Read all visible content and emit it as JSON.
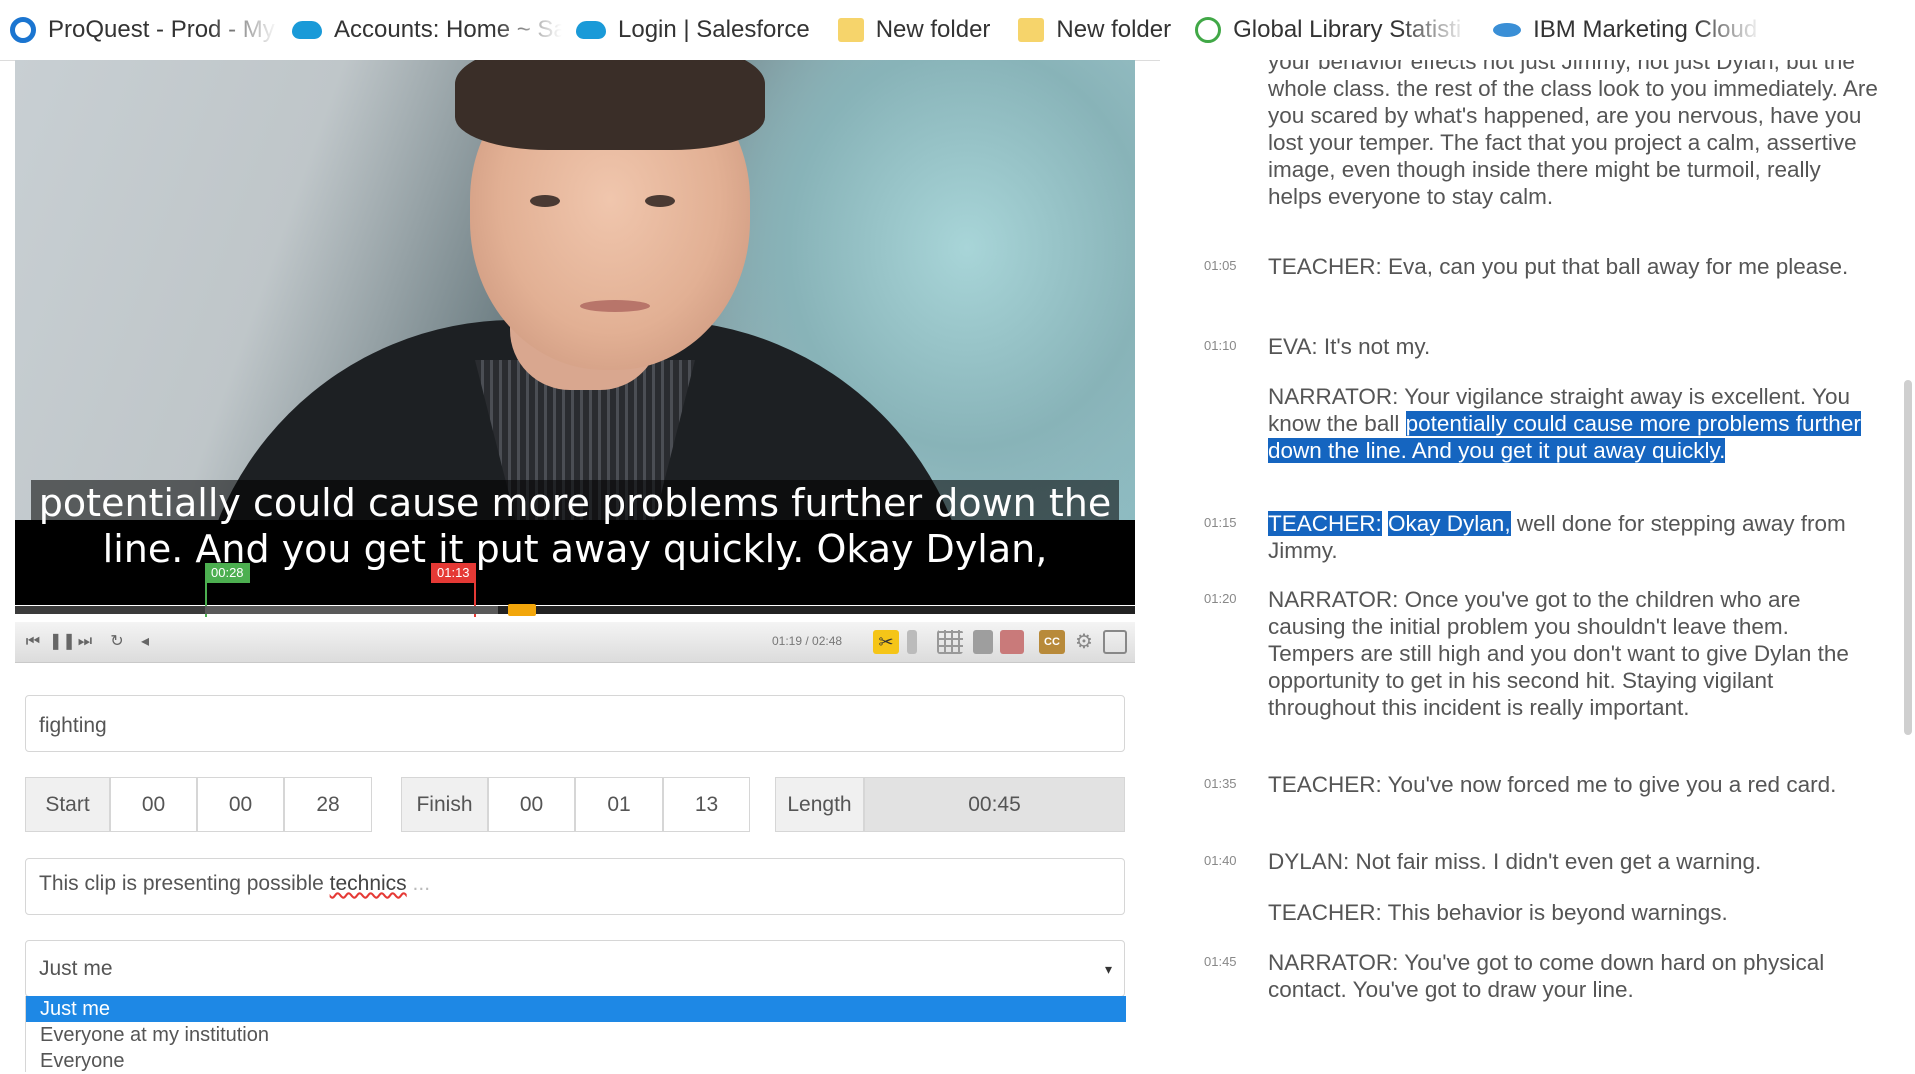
{
  "bookmarks": [
    {
      "label": "ProQuest - Prod - My",
      "icon": "proquest-icon"
    },
    {
      "label": "Accounts: Home ~ Sa",
      "icon": "salesforce-cloud-icon"
    },
    {
      "label": "Login | Salesforce",
      "icon": "salesforce-cloud-icon"
    },
    {
      "label": "New folder",
      "icon": "folder-icon"
    },
    {
      "label": "New folder",
      "icon": "folder-icon"
    },
    {
      "label": "Global Library Statisti",
      "icon": "global-library-icon"
    },
    {
      "label": "IBM Marketing Cloud",
      "icon": "ibm-cloud-icon"
    }
  ],
  "player": {
    "subtitle_line1": "potentially could cause more problems further down the",
    "subtitle_line2": "line. And you get it put away quickly. Okay Dylan,",
    "marker_start": "00:28",
    "marker_end": "01:13",
    "time_readout": "01:19 / 02:48",
    "progress": 0.37
  },
  "clip_form": {
    "tag_value": "fighting",
    "start_label": "Start",
    "start": [
      "00",
      "00",
      "28"
    ],
    "finish_label": "Finish",
    "finish": [
      "00",
      "01",
      "13"
    ],
    "length_label": "Length",
    "length_value": "00:45",
    "desc_prefix": "This clip is presenting possible ",
    "desc_misspelled": "technics",
    "desc_suffix": " ...",
    "share_selected": "Just me",
    "share_options": [
      "Just me",
      "Everyone at my institution",
      "Everyone"
    ]
  },
  "transcript": {
    "top_text": "your behavior effects not just Jimmy, not just Dylan, but the whole class. the rest of the class look to you immediately. Are you scared by what's happened, are you nervous, have you lost your temper. The fact that you project a calm, assertive image, even though inside there might be turmoil, really helps everyone to stay calm.",
    "entries": [
      {
        "time": "01:05",
        "text": "TEACHER: Eva, can you put that ball away for me please."
      },
      {
        "time": "01:10",
        "text": "EVA: It's not my."
      },
      {
        "time": "",
        "text_plain": "NARRATOR: Your vigilance straight away is excellent. You know the ball ",
        "text_hl": "potentially could cause more problems further down the line. And you get it put away quickly."
      },
      {
        "time": "01:15",
        "hl1": "TEACHER:",
        "hl2": "Okay Dylan,",
        "text_rest": " well done for stepping away from Jimmy."
      },
      {
        "time": "01:20",
        "text": "NARRATOR: Once you've got to the children who are causing the initial problem you shouldn't leave them. Tempers are still high and you don't want to give Dylan the opportunity to get in his second hit. Staying vigilant throughout this incident is really important."
      },
      {
        "time": "01:35",
        "text": "TEACHER: You've now forced me to give you a red card."
      },
      {
        "time": "01:40",
        "text": "DYLAN: Not fair miss. I didn't even get a warning."
      },
      {
        "time": "",
        "text": "TEACHER: This behavior is beyond warnings."
      },
      {
        "time": "01:45",
        "text": "NARRATOR: You've got to come down hard on physical contact. You've got to draw your line."
      }
    ]
  }
}
